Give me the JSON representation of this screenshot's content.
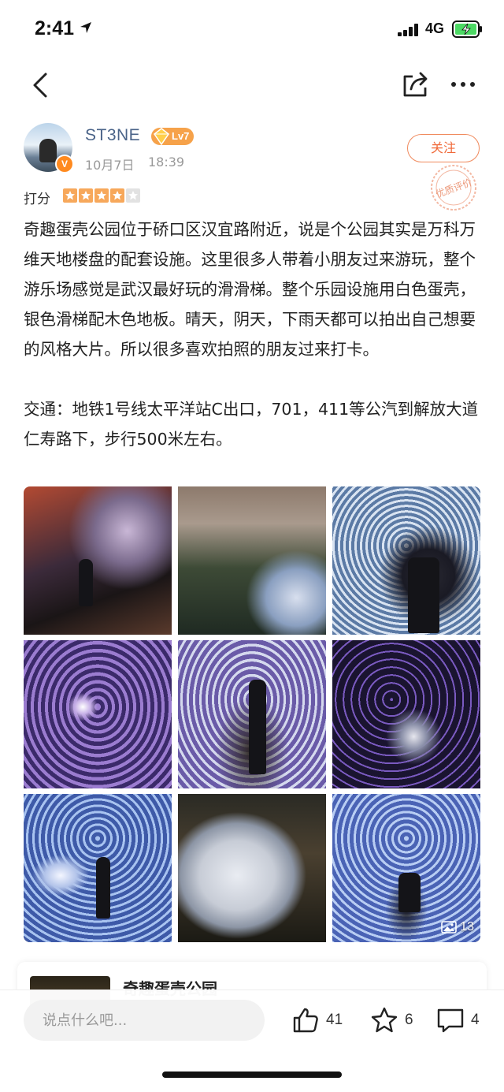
{
  "status_bar": {
    "time": "2:41",
    "network": "4G",
    "icons": [
      "location-arrow-icon",
      "signal-bars-icon",
      "battery-charging-icon"
    ],
    "battery_color": "#4cd964"
  },
  "nav": {
    "icons": [
      "back-arrow-icon",
      "share-icon",
      "more-dots-icon"
    ]
  },
  "author": {
    "name": "ST3NE",
    "verified_badge": "V",
    "level": "Lv7",
    "date": "10月7日",
    "time": "18:39",
    "follow_label": "关注",
    "quality_stamp": "优质评价"
  },
  "rating": {
    "label": "打分",
    "stars_filled": 4,
    "stars_total": 5,
    "star_color": "#f7a85b"
  },
  "post": {
    "paragraphs": [
      "奇趣蛋壳公园位于硚口区汉宜路附近，说是个公园其实是万科万维天地楼盘的配套设施。这里很多人带着小朋友过来游玩，整个游乐场感觉是武汉最好玩的滑滑梯。整个乐园设施用白色蛋壳，银色滑梯配木色地板。晴天，阴天，下雨天都可以拍出自己想要的风格大片。所以很多喜欢拍照的朋友过来打卡。",
      "交通：地铁1号线太平洋站C出口，701，411等公汽到解放大道仁寿路下，步行500米左右。"
    ]
  },
  "photos": {
    "count_label": "13",
    "items": [
      "photo-1",
      "photo-2",
      "photo-3",
      "photo-4",
      "photo-5",
      "photo-6",
      "photo-7",
      "photo-8",
      "photo-9"
    ]
  },
  "related": {
    "title": "奇趣蛋壳公园"
  },
  "bottom_bar": {
    "comment_placeholder": "说点什么吧...",
    "likes": "41",
    "favorites": "6",
    "comments": "4"
  },
  "colors": {
    "accent": "#f06a3a",
    "author_name": "#4a6388",
    "level_badge": "#f6a24a"
  }
}
